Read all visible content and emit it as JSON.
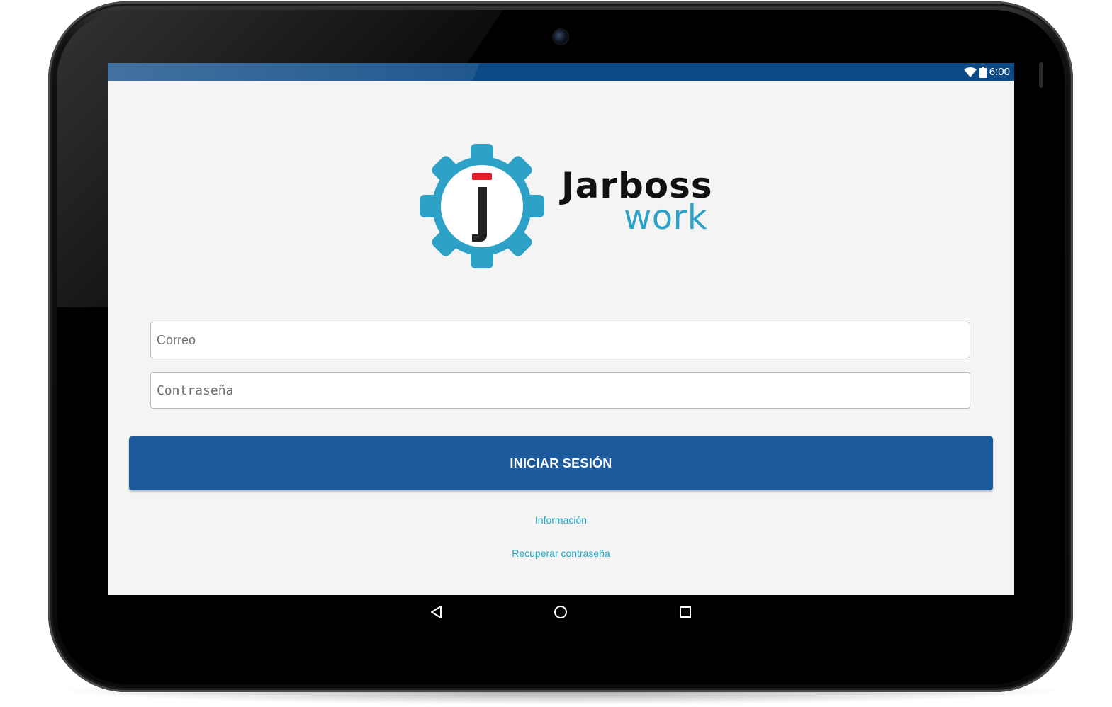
{
  "status_bar": {
    "time": "6:00",
    "icons": [
      "wifi-icon",
      "battery-icon"
    ],
    "color": "#0d4a85"
  },
  "logo": {
    "letter": "j",
    "brand": "Jarboss",
    "sub": "work",
    "gear_color": "#2ea1c7",
    "accent_color": "#e0202a"
  },
  "form": {
    "email_placeholder": "Correo",
    "password_placeholder": "Contraseña",
    "login_label": "INICIAR SESIÓN",
    "button_color": "#1c5a9b"
  },
  "links": {
    "info": "Información",
    "recover": "Recuperar contraseña",
    "color": "#21aac8"
  },
  "nav": {
    "icons": [
      "back-icon",
      "home-icon",
      "recents-icon"
    ]
  }
}
